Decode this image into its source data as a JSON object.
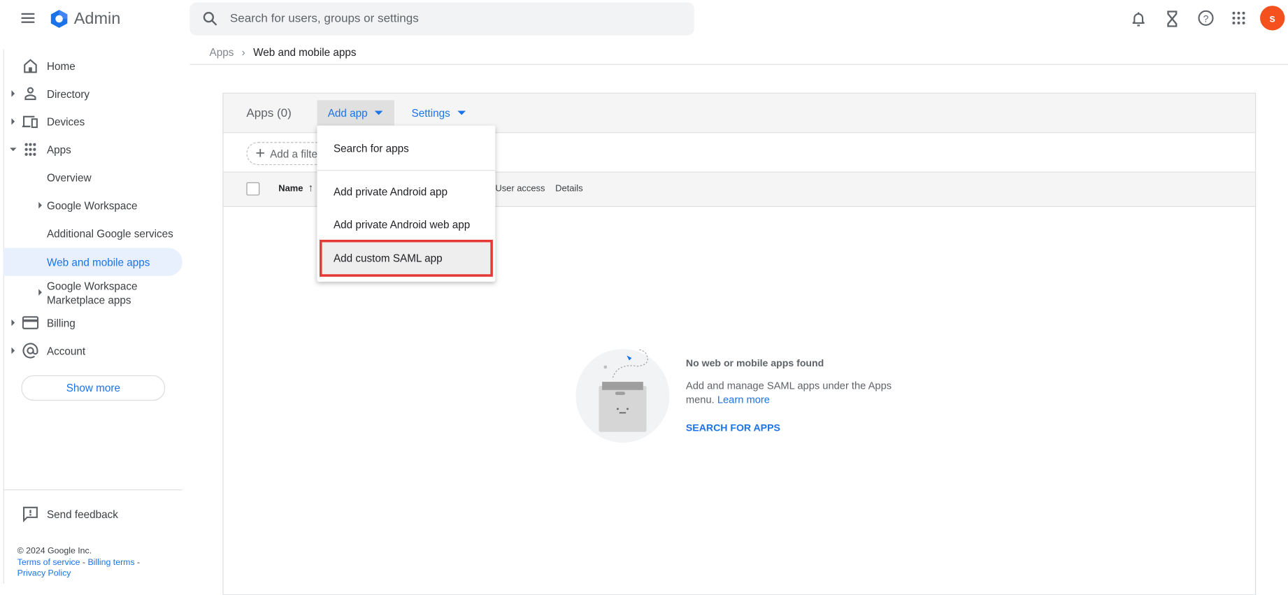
{
  "header": {
    "app_name": "Admin",
    "search_placeholder": "Search for users, groups or settings",
    "avatar_letter": "S",
    "avatar_color": "#f4511e"
  },
  "breadcrumb": {
    "parent": "Apps",
    "separator": ">",
    "current": "Web and mobile apps"
  },
  "sidebar": {
    "items": [
      {
        "label": "Home",
        "icon": "home-icon"
      },
      {
        "label": "Directory",
        "icon": "person-icon"
      },
      {
        "label": "Devices",
        "icon": "devices-icon"
      },
      {
        "label": "Apps",
        "icon": "apps-grid-icon"
      },
      {
        "label": "Overview"
      },
      {
        "label": "Google Workspace"
      },
      {
        "label": "Additional Google services"
      },
      {
        "label": "Web and mobile apps",
        "selected": true
      },
      {
        "label": "Google Workspace Marketplace apps",
        "line1": "Google Workspace",
        "line2": "Marketplace apps"
      },
      {
        "label": "Billing",
        "icon": "credit-card-icon"
      },
      {
        "label": "Account",
        "icon": "at-sign-icon"
      }
    ],
    "show_more": "Show more",
    "send_feedback": "Send feedback",
    "copyright": "© 2024 Google Inc.",
    "links": {
      "terms": "Terms of service",
      "billing": "Billing terms",
      "privacy": "Privacy Policy",
      "sep": " - "
    }
  },
  "card": {
    "title": "Apps (0)",
    "add_app": "Add app",
    "settings": "Settings",
    "add_filter": "Add a filter",
    "columns": {
      "name": "Name",
      "user_access": "User access",
      "details": "Details"
    }
  },
  "dropdown": {
    "items": [
      "Search for apps",
      "Add private Android app",
      "Add private Android web app",
      "Add custom SAML app"
    ],
    "highlighted": "Add custom SAML app",
    "highlight_color": "#e53935"
  },
  "empty_state": {
    "title": "No web or mobile apps found",
    "text": "Add and manage SAML apps under the Apps",
    "text2": "menu.",
    "learn_more": "Learn more",
    "action": "SEARCH FOR APPS"
  }
}
